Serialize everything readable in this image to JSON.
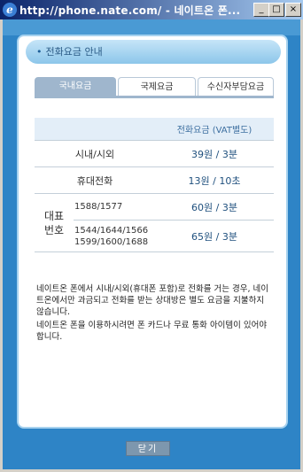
{
  "window": {
    "title": "http://phone.nate.com/ - 네이트온 폰...",
    "minimize": "_",
    "maximize": "□",
    "close": "×"
  },
  "header": {
    "bullet": "•",
    "title": "전화요금 안내"
  },
  "tabs": [
    {
      "label": "국내요금",
      "active": true
    },
    {
      "label": "국제요금",
      "active": false
    },
    {
      "label": "수신자부담요금",
      "active": false
    }
  ],
  "table": {
    "header": "전화요금 (VAT별도)",
    "rows": [
      {
        "label": "시내/시외",
        "value": "39원 / 3분"
      },
      {
        "label": "휴대전화",
        "value": "13원 / 10초"
      }
    ],
    "representative": {
      "label": "대표 번호",
      "rows": [
        {
          "numbers": "1588/1577",
          "value": "60원 / 3분"
        },
        {
          "numbers": "1544/1644/1566 1599/1600/1688",
          "value": "65원 / 3분"
        }
      ]
    }
  },
  "notes": [
    "네이트온 폰에서 시내/시외(휴대폰 포함)로 전화를 거는 경우, 네이트온에서만 과금되고 전화를 받는 상대방은 별도 요금을 지불하지 않습니다.",
    "네이트온 폰을 이용하시려면 폰 카드나 무료 통화 아이템이 있어야 합니다."
  ],
  "close_button": "닫기"
}
